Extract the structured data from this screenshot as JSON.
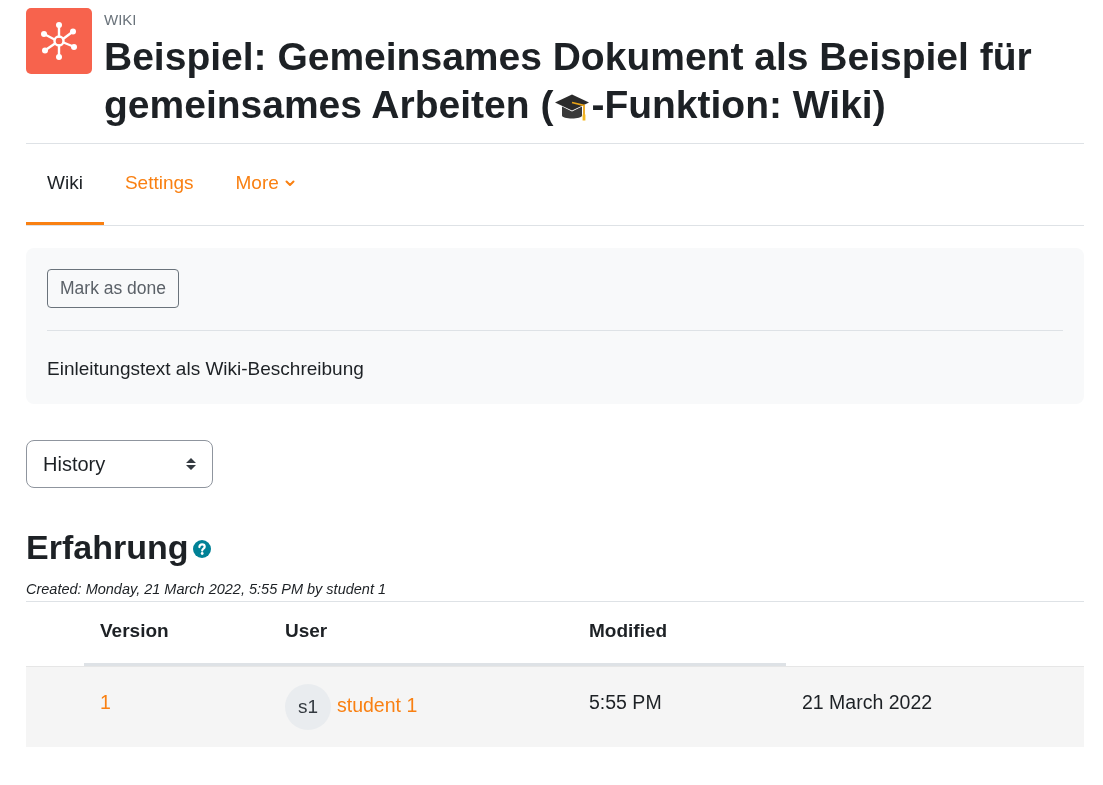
{
  "activity": {
    "type_label": "WIKI",
    "title_parts": [
      "Beispiel: Gemeinsames Dokument als Beispiel für",
      "gemeinsames Arbeiten (",
      "-Funktion: Wiki)"
    ]
  },
  "tabs": [
    {
      "label": "Wiki",
      "selected": true,
      "dropdown": false
    },
    {
      "label": "Settings",
      "selected": false,
      "dropdown": false
    },
    {
      "label": "More",
      "selected": false,
      "dropdown": true
    }
  ],
  "intro": {
    "button": "Mark as done",
    "description": "Einleitungstext als Wiki-Beschreibung"
  },
  "action_select": {
    "value": "History"
  },
  "history": {
    "heading": "Erfahrung",
    "created": "Created: Monday, 21 March 2022, 5:55 PM by student 1",
    "table": {
      "columns": [
        "Version",
        "User",
        "Modified"
      ],
      "rows": [
        {
          "version": "1",
          "user": {
            "initials": "s1",
            "name": "student 1"
          },
          "modified": "5:55 PM",
          "column_4": "21 March 2022"
        }
      ]
    }
  }
}
